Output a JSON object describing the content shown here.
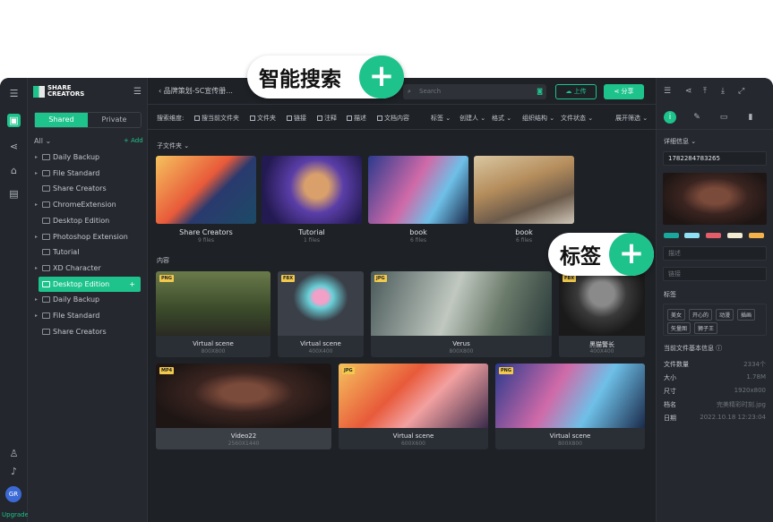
{
  "brand": {
    "line1": "SHARE",
    "line2": "CREATORS"
  },
  "sidebar": {
    "tabs": [
      "Shared",
      "Private"
    ],
    "all_label": "All",
    "add_label": "+ Add",
    "items": [
      {
        "label": "Daily Backup",
        "arrow": "▸"
      },
      {
        "label": "File Standard",
        "arrow": "▸"
      },
      {
        "label": "Share Creators",
        "arrow": ""
      },
      {
        "label": "ChromeExtension",
        "arrow": "▸"
      },
      {
        "label": "Desktop Edition",
        "arrow": ""
      },
      {
        "label": "Photoshop Extension",
        "arrow": "▸"
      },
      {
        "label": "Tutorial",
        "arrow": ""
      },
      {
        "label": "XD Character",
        "arrow": "▸"
      },
      {
        "label": "Desktop Edition",
        "arrow": "▸",
        "selected": true
      },
      {
        "label": "Daily Backup",
        "arrow": "▸"
      },
      {
        "label": "File Standard",
        "arrow": "▸"
      },
      {
        "label": "Share Creators",
        "arrow": ""
      }
    ]
  },
  "rail": {
    "avatar": "GR",
    "upgrade": "Upgrade"
  },
  "header": {
    "breadcrumb": "‹ 品牌策划-SC宣传册...",
    "search_placeholder": "Search",
    "upload": "上传",
    "share": "分享"
  },
  "filters": {
    "label": "搜索维度:",
    "checks": [
      "搜当前文件夹",
      "文件夹",
      "链接",
      "注释",
      "描述",
      "文档内容"
    ],
    "drops": [
      "标签 ⌄",
      "创建人 ⌄",
      "格式 ⌄",
      "组织结构 ⌄",
      "文件状态 ⌄"
    ],
    "expand": "展开筛选 ⌄"
  },
  "main": {
    "subfolder_title": "子文件夹 ⌄",
    "content_title": "内容",
    "folders": [
      {
        "name": "Share Creators",
        "count": "9 files"
      },
      {
        "name": "Tutorial",
        "count": "1 files"
      },
      {
        "name": "book",
        "count": "6 files"
      },
      {
        "name": "book",
        "count": "6 files"
      }
    ],
    "cards": [
      {
        "badge": "PNG",
        "name": "Virtual scene",
        "dim": "800X800"
      },
      {
        "badge": "FBX",
        "name": "Virtual scene",
        "dim": "400X400"
      },
      {
        "badge": "JPG",
        "name": "Verus",
        "dim": "800X800"
      },
      {
        "badge": "FBX",
        "name": "黑猫警长",
        "dim": "400X400"
      },
      {
        "badge": "MP4",
        "name": "Video22",
        "dim": "2560X1440"
      },
      {
        "badge": "JPG",
        "name": "Virtual scene",
        "dim": "600X600"
      },
      {
        "badge": "PNG",
        "name": "Virtual scene",
        "dim": "800X800"
      }
    ]
  },
  "details": {
    "title": "详细信息 ⌄",
    "id": "1782284783265",
    "colors": [
      "#1aa89c",
      "#8fe0f5",
      "#e35d6a",
      "#f3ecd1",
      "#f5b14a"
    ],
    "desc_placeholder": "描述",
    "link_placeholder": "链接",
    "tags_title": "标签",
    "tags": [
      "美女",
      "开心的",
      "动漫",
      "插画",
      "矢量图",
      "狮子王"
    ],
    "info_title": "当前文件基本信息 ⓘ",
    "info": [
      {
        "k": "文件数量",
        "v": "2334个"
      },
      {
        "k": "大小",
        "v": "1.78M"
      },
      {
        "k": "尺寸",
        "v": "1920x800"
      },
      {
        "k": "档名",
        "v": "完美精彩时刻.jpg"
      },
      {
        "k": "日期",
        "v": "2022.10.18 12:23:04"
      }
    ]
  },
  "callouts": {
    "search": "智能搜索",
    "tag": "标签",
    "plus": "+"
  }
}
